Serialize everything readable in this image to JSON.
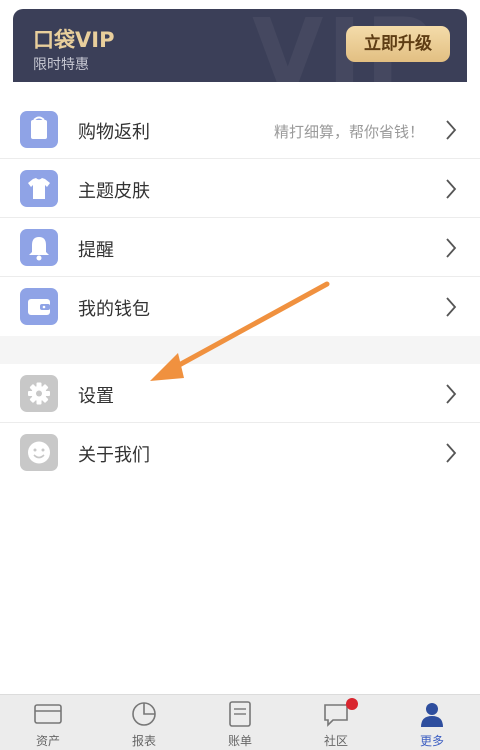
{
  "vip": {
    "title": "口袋VIP",
    "subtitle": "限时特惠",
    "upgrade_label": "立即升级",
    "watermark": "VIP"
  },
  "menu_group1": [
    {
      "label": "购物返利",
      "hint": "精打细算，帮你省钱！",
      "icon": "shopping-bag-icon"
    },
    {
      "label": "主题皮肤",
      "hint": "",
      "icon": "tshirt-icon"
    },
    {
      "label": "提醒",
      "hint": "",
      "icon": "bell-icon"
    },
    {
      "label": "我的钱包",
      "hint": "",
      "icon": "wallet-icon"
    }
  ],
  "menu_group2": [
    {
      "label": "设置",
      "icon": "gear-icon"
    },
    {
      "label": "关于我们",
      "icon": "smiley-icon"
    }
  ],
  "tabs": [
    {
      "label": "资产",
      "icon": "card-icon"
    },
    {
      "label": "报表",
      "icon": "pie-chart-icon"
    },
    {
      "label": "账单",
      "icon": "document-icon"
    },
    {
      "label": "社区",
      "icon": "chat-icon",
      "has_badge": true
    },
    {
      "label": "更多",
      "icon": "person-icon",
      "active": true
    }
  ],
  "colors": {
    "vip_bg": "#3b3f58",
    "vip_gold": "#e9cf9c",
    "icon_blue": "#8fa3e6",
    "icon_gray": "#c8c8c8",
    "active_tab": "#3d5fc2",
    "badge_red": "#d9262f",
    "arrow_orange": "#f0913f"
  }
}
